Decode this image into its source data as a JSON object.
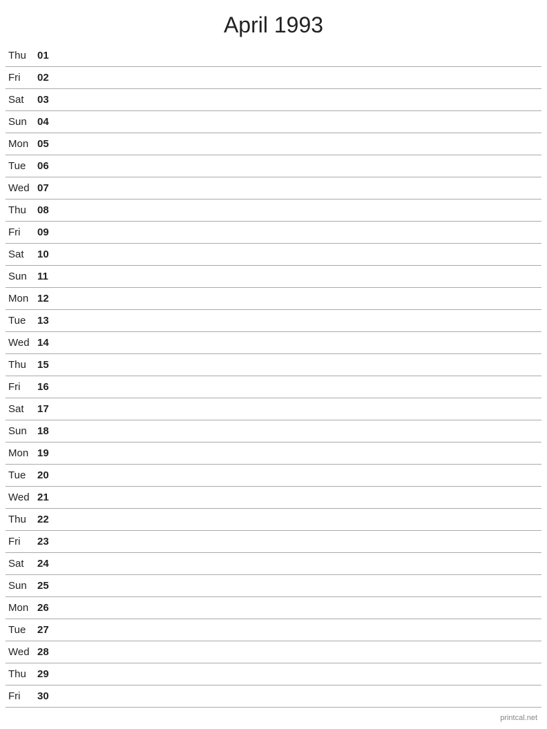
{
  "page": {
    "title": "April 1993"
  },
  "days": [
    {
      "name": "Thu",
      "number": "01"
    },
    {
      "name": "Fri",
      "number": "02"
    },
    {
      "name": "Sat",
      "number": "03"
    },
    {
      "name": "Sun",
      "number": "04"
    },
    {
      "name": "Mon",
      "number": "05"
    },
    {
      "name": "Tue",
      "number": "06"
    },
    {
      "name": "Wed",
      "number": "07"
    },
    {
      "name": "Thu",
      "number": "08"
    },
    {
      "name": "Fri",
      "number": "09"
    },
    {
      "name": "Sat",
      "number": "10"
    },
    {
      "name": "Sun",
      "number": "11"
    },
    {
      "name": "Mon",
      "number": "12"
    },
    {
      "name": "Tue",
      "number": "13"
    },
    {
      "name": "Wed",
      "number": "14"
    },
    {
      "name": "Thu",
      "number": "15"
    },
    {
      "name": "Fri",
      "number": "16"
    },
    {
      "name": "Sat",
      "number": "17"
    },
    {
      "name": "Sun",
      "number": "18"
    },
    {
      "name": "Mon",
      "number": "19"
    },
    {
      "name": "Tue",
      "number": "20"
    },
    {
      "name": "Wed",
      "number": "21"
    },
    {
      "name": "Thu",
      "number": "22"
    },
    {
      "name": "Fri",
      "number": "23"
    },
    {
      "name": "Sat",
      "number": "24"
    },
    {
      "name": "Sun",
      "number": "25"
    },
    {
      "name": "Mon",
      "number": "26"
    },
    {
      "name": "Tue",
      "number": "27"
    },
    {
      "name": "Wed",
      "number": "28"
    },
    {
      "name": "Thu",
      "number": "29"
    },
    {
      "name": "Fri",
      "number": "30"
    }
  ],
  "footer": {
    "text": "printcal.net"
  }
}
